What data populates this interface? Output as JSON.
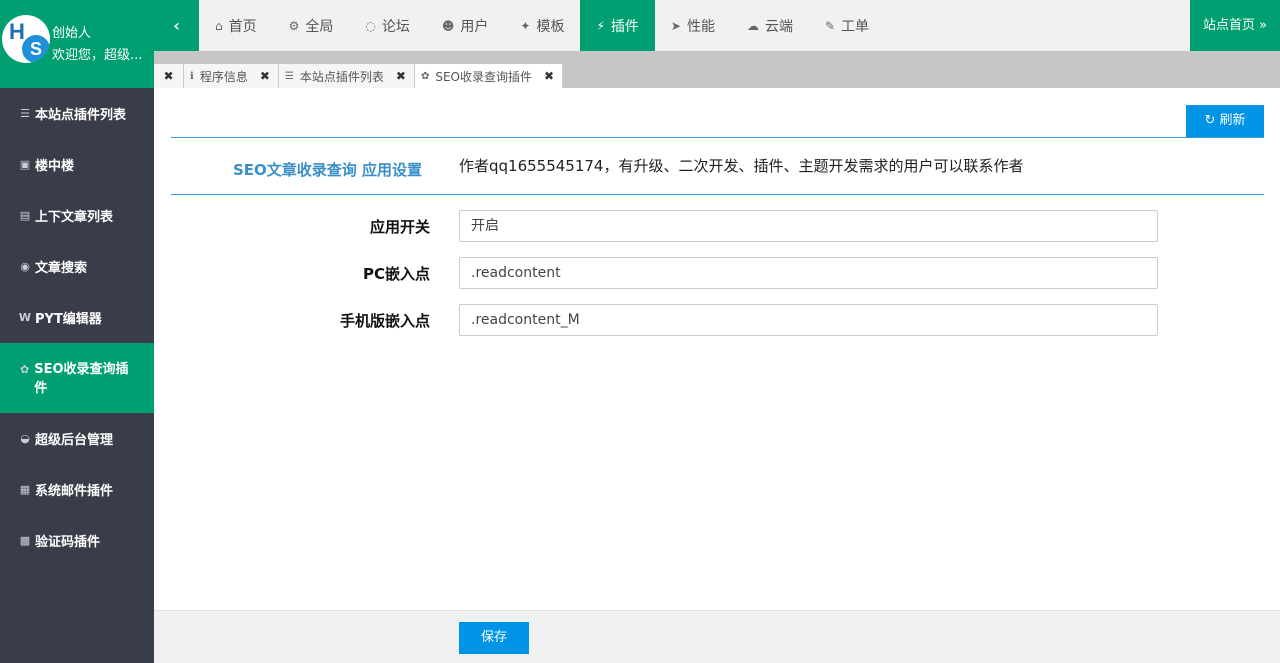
{
  "brand": {
    "name": "创始人",
    "welcome": "欢迎您，超级...",
    "logo_letters": [
      "H",
      "S"
    ]
  },
  "topbar": {
    "toggle_icon": "chevron-left-icon",
    "menu": [
      {
        "label": "首页",
        "icon": "home-icon",
        "glyph": "⌂"
      },
      {
        "label": "全局",
        "icon": "gears-icon",
        "glyph": "⚙"
      },
      {
        "label": "论坛",
        "icon": "comments-icon",
        "glyph": "◌"
      },
      {
        "label": "用户",
        "icon": "users-icon",
        "glyph": "☻"
      },
      {
        "label": "模板",
        "icon": "puzzle-icon",
        "glyph": "✦"
      },
      {
        "label": "插件",
        "icon": "plug-icon",
        "glyph": "⚡",
        "active": true
      },
      {
        "label": "性能",
        "icon": "paper-plane-icon",
        "glyph": "➤"
      },
      {
        "label": "云端",
        "icon": "cloud-icon",
        "glyph": "☁"
      },
      {
        "label": "工单",
        "icon": "wrench-icon",
        "glyph": "✎"
      }
    ],
    "site_home": "站点首页 »"
  },
  "tabs": [
    {
      "label": "程序信息",
      "glyph": "ℹ"
    },
    {
      "label": "本站点插件列表",
      "glyph": "☰"
    },
    {
      "label": "SEO收录查询插件",
      "glyph": "✿",
      "active": true
    }
  ],
  "sidebar": {
    "items": [
      {
        "label": "本站点插件列表",
        "glyph": "☰"
      },
      {
        "label": "楼中楼",
        "glyph": "▣"
      },
      {
        "label": "上下文章列表",
        "glyph": "▤"
      },
      {
        "label": "文章搜索",
        "glyph": "◉"
      },
      {
        "label": "PYT编辑器",
        "glyph": "W"
      },
      {
        "label": "SEO收录查询插件",
        "glyph": "✿",
        "active": true
      },
      {
        "label": "超级后台管理",
        "glyph": "◒"
      },
      {
        "label": "系统邮件插件",
        "glyph": "▦"
      },
      {
        "label": "验证码插件",
        "glyph": "▩"
      }
    ]
  },
  "content": {
    "refresh_label": "刷新",
    "section_title": "SEO文章收录查询 应用设置",
    "section_note": "作者qq1655545174，有升级、二次开发、插件、主题开发需求的用户可以联系作者",
    "fields": [
      {
        "label": "应用开关",
        "value": "开启"
      },
      {
        "label": "PC嵌入点",
        "value": ".readcontent"
      },
      {
        "label": "手机版嵌入点",
        "value": ".readcontent_M"
      }
    ]
  },
  "footer": {
    "save_label": "保存"
  },
  "colors": {
    "primary_green": "#009f72",
    "sidebar_dark": "#393d49",
    "accent_blue": "#0094e6",
    "title_blue": "#3a8fc8"
  }
}
